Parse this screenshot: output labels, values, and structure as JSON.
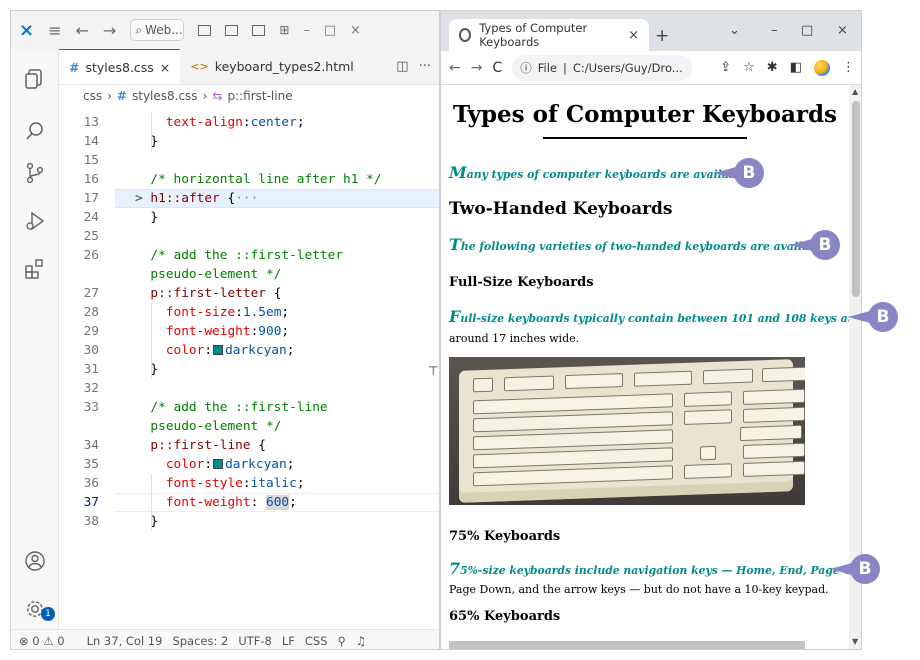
{
  "vscode": {
    "search_label": "Web...",
    "tabs": [
      {
        "label": "styles8.css",
        "icon": "#"
      },
      {
        "label": "keyboard_types2.html",
        "icon": "<>"
      }
    ],
    "breadcrumb": [
      "css",
      "styles8.css",
      "p::first-line"
    ],
    "lines": [
      {
        "n": "13",
        "parts": [
          {
            "t": "    ",
            "c": ""
          },
          {
            "t": "text-align",
            "c": "c-prop"
          },
          {
            "t": ":",
            "c": "c-pun"
          },
          {
            "t": "center",
            "c": "c-val"
          },
          {
            "t": ";",
            "c": "c-pun"
          }
        ]
      },
      {
        "n": "14",
        "parts": [
          {
            "t": "  }",
            "c": "c-pun"
          }
        ]
      },
      {
        "n": "15",
        "parts": []
      },
      {
        "n": "16",
        "parts": [
          {
            "t": "  /* horizontal line after h1 */",
            "c": "c-cmt"
          }
        ]
      },
      {
        "n": "17",
        "fold": true,
        "parts": [
          {
            "t": "> ",
            "c": "fold-arrow"
          },
          {
            "t": "h1::after",
            "c": "c-sel"
          },
          {
            "t": " {",
            "c": "c-pun"
          },
          {
            "t": "···",
            "c": "ellipsis"
          }
        ]
      },
      {
        "n": "24",
        "parts": [
          {
            "t": "  }",
            "c": "c-pun"
          }
        ]
      },
      {
        "n": "25",
        "parts": []
      },
      {
        "n": "26",
        "parts": [
          {
            "t": "  /* add the ::first-letter",
            "c": "c-cmt"
          }
        ]
      },
      {
        "n": "",
        "parts": [
          {
            "t": "  pseudo-element */",
            "c": "c-cmt"
          }
        ]
      },
      {
        "n": "27",
        "parts": [
          {
            "t": "  p::first-letter",
            "c": "c-sel"
          },
          {
            "t": " {",
            "c": "c-pun"
          }
        ]
      },
      {
        "n": "28",
        "parts": [
          {
            "t": "    font-size",
            "c": "c-prop"
          },
          {
            "t": ":",
            "c": "c-pun"
          },
          {
            "t": "1.5em",
            "c": "c-val"
          },
          {
            "t": ";",
            "c": "c-pun"
          }
        ]
      },
      {
        "n": "29",
        "parts": [
          {
            "t": "    font-weight",
            "c": "c-prop"
          },
          {
            "t": ":",
            "c": "c-pun"
          },
          {
            "t": "900",
            "c": "c-val"
          },
          {
            "t": ";",
            "c": "c-pun"
          }
        ]
      },
      {
        "n": "30",
        "parts": [
          {
            "t": "    color",
            "c": "c-prop"
          },
          {
            "t": ":",
            "c": "c-pun"
          },
          {
            "t": "SW",
            "c": "swatch"
          },
          {
            "t": "darkcyan",
            "c": "c-val"
          },
          {
            "t": ";",
            "c": "c-pun"
          }
        ]
      },
      {
        "n": "31",
        "parts": [
          {
            "t": "  }",
            "c": "c-pun"
          }
        ]
      },
      {
        "n": "32",
        "parts": []
      },
      {
        "n": "33",
        "parts": [
          {
            "t": "  /* add the ::first-line",
            "c": "c-cmt"
          }
        ]
      },
      {
        "n": "",
        "parts": [
          {
            "t": "  pseudo-element */",
            "c": "c-cmt"
          }
        ]
      },
      {
        "n": "34",
        "parts": [
          {
            "t": "  p::first-line",
            "c": "c-sel"
          },
          {
            "t": " {",
            "c": "c-pun"
          }
        ]
      },
      {
        "n": "35",
        "parts": [
          {
            "t": "    color",
            "c": "c-prop"
          },
          {
            "t": ":",
            "c": "c-pun"
          },
          {
            "t": "SW",
            "c": "swatch"
          },
          {
            "t": "darkcyan",
            "c": "c-val"
          },
          {
            "t": ";",
            "c": "c-pun"
          }
        ]
      },
      {
        "n": "36",
        "parts": [
          {
            "t": "    font-style",
            "c": "c-prop"
          },
          {
            "t": ":",
            "c": "c-pun"
          },
          {
            "t": "italic",
            "c": "c-val"
          },
          {
            "t": ";",
            "c": "c-pun"
          }
        ]
      },
      {
        "n": "37",
        "current": true,
        "parts": [
          {
            "t": "    font-weight",
            "c": "c-prop"
          },
          {
            "t": ": ",
            "c": "c-pun"
          },
          {
            "t": "600",
            "c": "c-val wordhl"
          },
          {
            "t": ";",
            "c": "c-pun"
          }
        ]
      },
      {
        "n": "38",
        "parts": [
          {
            "t": "  }",
            "c": "c-pun"
          }
        ]
      }
    ],
    "status": {
      "errors": "0",
      "warnings": "0",
      "position": "Ln 37, Col 19",
      "spaces": "Spaces: 2",
      "encoding": "UTF-8",
      "eol": "LF",
      "language": "CSS"
    },
    "badge_count": "1"
  },
  "chrome": {
    "tab_title": "Types of Computer Keyboards",
    "omnibox_scheme": "File",
    "omnibox_path": "C:/Users/Guy/Dro...",
    "page": {
      "h1": "Types of Computer Keyboards",
      "p1_first": "M",
      "p1_rest": "any types of computer keyboards are available.",
      "h2": "Two-Handed Keyboards",
      "p2_first": "T",
      "p2_rest": "he following varieties of two-handed keyboards are available.",
      "h3a": "Full-Size Keyboards",
      "p3_first": "F",
      "p3_rest": "ull-size keyboards typically contain between 101 and 108 keys and are",
      "p3_line2": "around 17 inches wide.",
      "h3b": "75% Keyboards",
      "p4_first": "7",
      "p4_rest": "5%-size keyboards include navigation keys — Home, End, Page Up,",
      "p4_line2": "Page Down, and the arrow keys — but do not have a 10-key keypad.",
      "h3c": "65% Keyboards"
    }
  },
  "callout_label": "B",
  "colors": {
    "accent": "#0078d4",
    "darkcyan": "#008b8b",
    "callout": "#8a85c4"
  }
}
